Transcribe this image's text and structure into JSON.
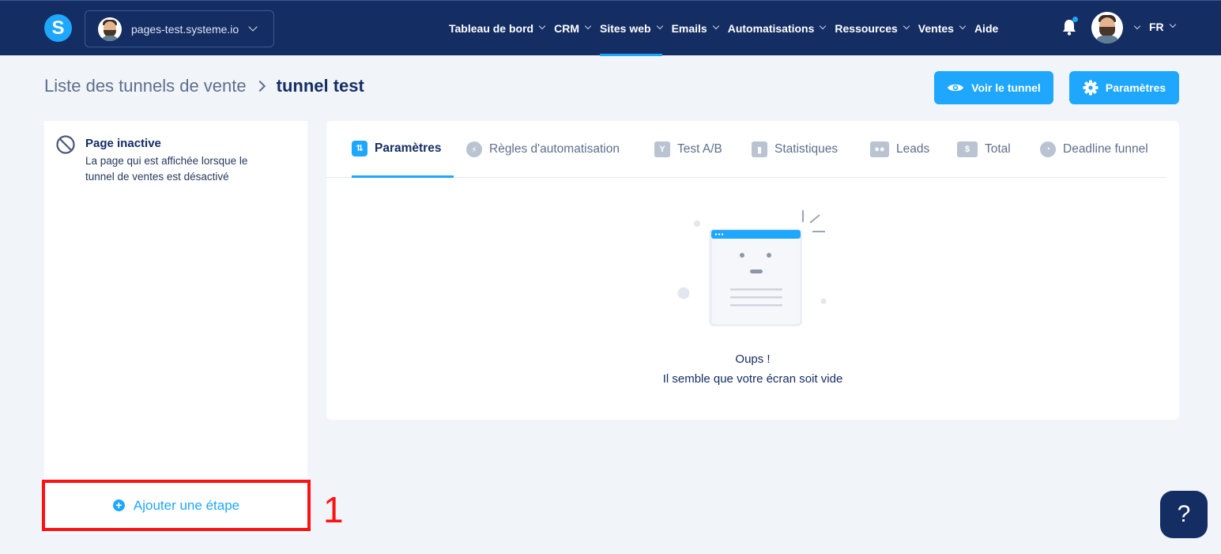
{
  "topbar": {
    "logo_letter": "S",
    "site_name": "pages-test.systeme.io",
    "nav": [
      {
        "label": "Tableau de bord"
      },
      {
        "label": "CRM"
      },
      {
        "label": "Sites web"
      },
      {
        "label": "Emails"
      },
      {
        "label": "Automatisations"
      },
      {
        "label": "Ressources"
      },
      {
        "label": "Ventes"
      },
      {
        "label": "Aide"
      }
    ],
    "language": "FR"
  },
  "header": {
    "breadcrumb_root": "Liste des tunnels de vente",
    "breadcrumb_current": "tunnel test",
    "view_button": "Voir le tunnel",
    "settings_button": "Paramètres"
  },
  "left_panel": {
    "inactive_title": "Page inactive",
    "inactive_desc": "La page qui est affichée lorsque le tunnel de ventes est désactivé",
    "add_step": "Ajouter une étape",
    "annotation_number": "1"
  },
  "tabs": [
    {
      "label": "Paramètres",
      "active": true
    },
    {
      "label": "Règles d'automatisation"
    },
    {
      "label": "Test A/B"
    },
    {
      "label": "Statistiques"
    },
    {
      "label": "Leads"
    },
    {
      "label": "Total"
    },
    {
      "label": "Deadline funnel"
    }
  ],
  "empty_state": {
    "line1": "Oups !",
    "line2": "Il semble que votre écran soit vide"
  },
  "help_button": "?",
  "colors": {
    "navy": "#142d63",
    "accent": "#1ea7fd",
    "background": "#f1f4f9",
    "annotation": "#ff1111"
  }
}
